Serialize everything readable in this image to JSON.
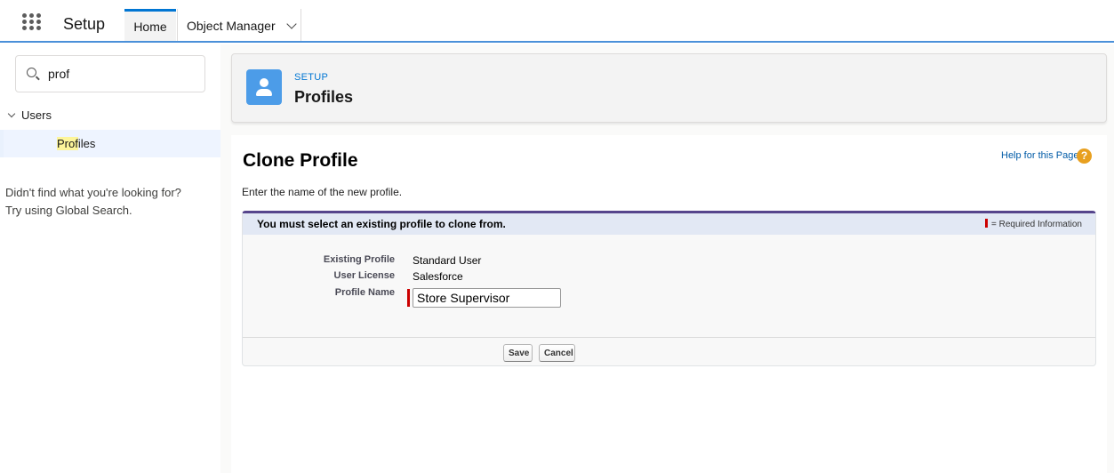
{
  "topnav": {
    "app_name": "Setup",
    "tabs": [
      {
        "label": "Home"
      },
      {
        "label": "Object Manager"
      }
    ]
  },
  "sidebar": {
    "quick_find_value": "prof",
    "tree": {
      "group_label": "Users",
      "item_match": "Prof",
      "item_rest": "iles"
    },
    "no_result_line1": "Didn't find what you're looking for?",
    "no_result_line2": "Try using Global Search."
  },
  "setup_header": {
    "eyebrow": "SETUP",
    "title": "Profiles"
  },
  "content": {
    "page_title": "Clone Profile",
    "help_link": "Help for this Page",
    "help_icon": "?",
    "instructions": "Enter the name of the new profile.",
    "block": {
      "error_message": "You must select an existing profile to clone from.",
      "required_legend": "= Required Information",
      "fields": {
        "existing_profile_label": "Existing Profile",
        "existing_profile_value": "Standard User",
        "user_license_label": "User License",
        "user_license_value": "Salesforce",
        "profile_name_label": "Profile Name",
        "profile_name_value": "Store Supervisor"
      },
      "buttons": {
        "save": "Save",
        "cancel": "Cancel"
      }
    }
  },
  "colors": {
    "brand_blue": "#0176d3",
    "header_icon": "#4c9ce8",
    "required_red": "#cc0000",
    "block_accent": "#56458c",
    "help_orange": "#e8a020"
  }
}
